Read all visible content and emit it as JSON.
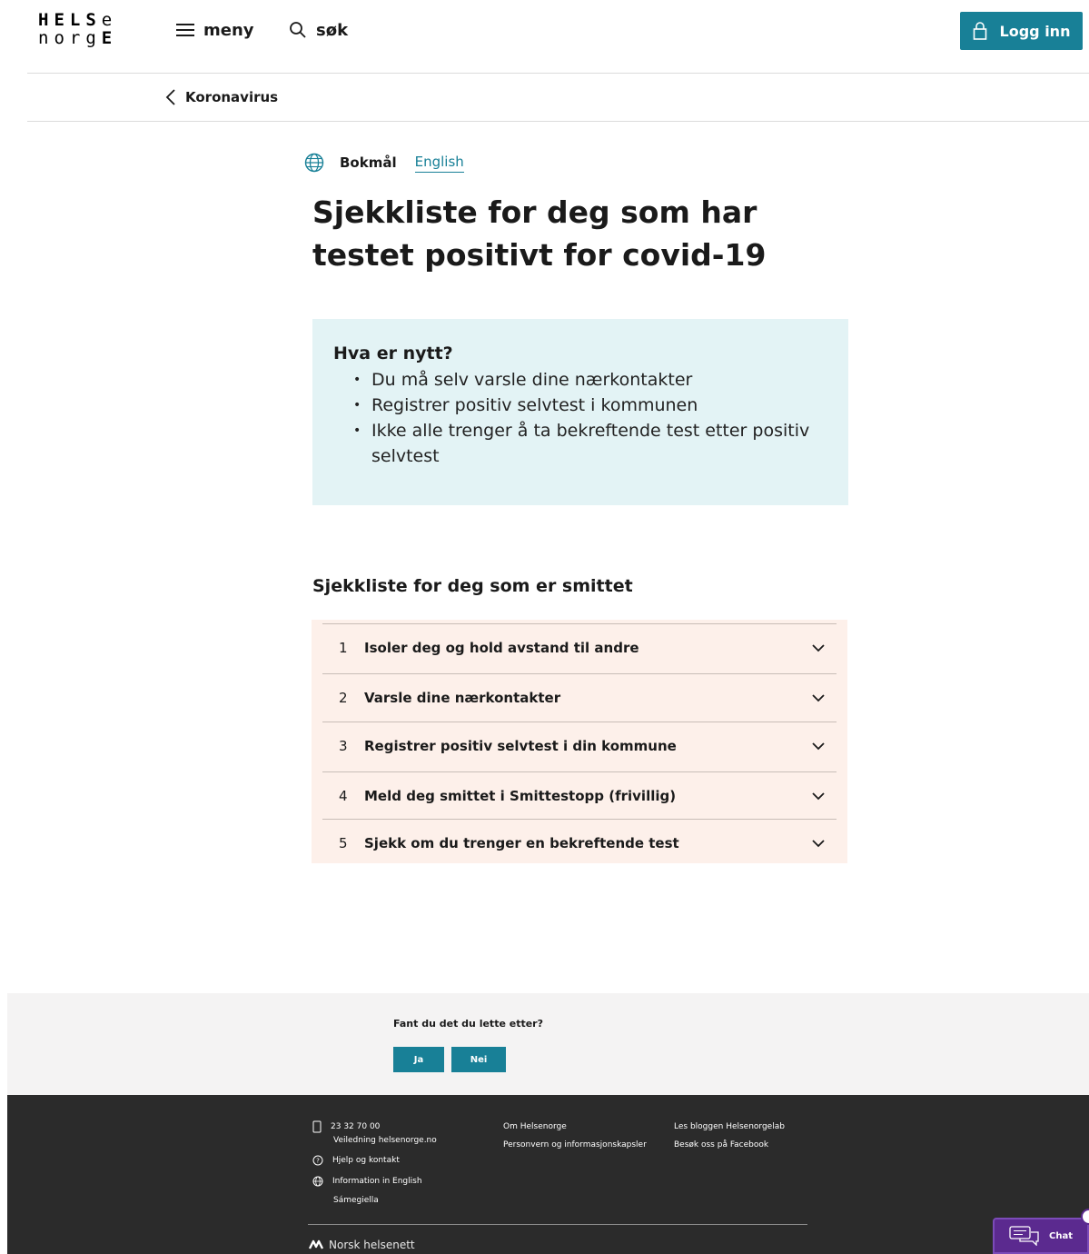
{
  "header": {
    "logo_line1": "HELSe",
    "logo_line2": "norgE",
    "menu_label": "meny",
    "search_label": "søk",
    "login_label": "Logg inn"
  },
  "breadcrumb": {
    "label": "Koronavirus"
  },
  "language": {
    "active": "Bokmål",
    "alternate": "English"
  },
  "page": {
    "title": "Sjekkliste for deg som har testet positivt for covid-19"
  },
  "news": {
    "heading": "Hva er nytt?",
    "items": [
      "Du må selv varsle dine nærkontakter",
      "Registrer positiv selvtest i kommunen",
      "Ikke alle trenger å ta bekreftende test etter positiv selvtest"
    ]
  },
  "checklist": {
    "title": "Sjekkliste for deg som er smittet",
    "items": [
      {
        "num": "1",
        "label": "Isoler deg og hold avstand til andre"
      },
      {
        "num": "2",
        "label": "Varsle dine nærkontakter"
      },
      {
        "num": "3",
        "label": "Registrer positiv selvtest i din kommune"
      },
      {
        "num": "4",
        "label": "Meld deg smittet i Smittestopp (frivillig)"
      },
      {
        "num": "5",
        "label": "Sjekk om du trenger en bekreftende test"
      }
    ]
  },
  "feedback": {
    "question": "Fant du det du lette etter?",
    "yes": "Ja",
    "no": "Nei"
  },
  "footer": {
    "phone": "23 32 70 00",
    "phone_sub": "Veiledning helsenorge.no",
    "help": "Hjelp og kontakt",
    "english": "Information in English",
    "sami": "Sámegiella",
    "about": "Om Helsenorge",
    "privacy": "Personvern og informasjonskapsler",
    "blog": "Les bloggen Helsenorgelab",
    "facebook": "Besøk oss på Facebook",
    "brand": "Norsk helsenett"
  },
  "chat": {
    "label": "Chat"
  },
  "colors": {
    "primary": "#188097",
    "news_bg": "#e3f3f5",
    "accordion_bg": "#fdf0ea",
    "footer_bg": "#2b2b2b",
    "chat_bg": "#5b2a8f"
  }
}
